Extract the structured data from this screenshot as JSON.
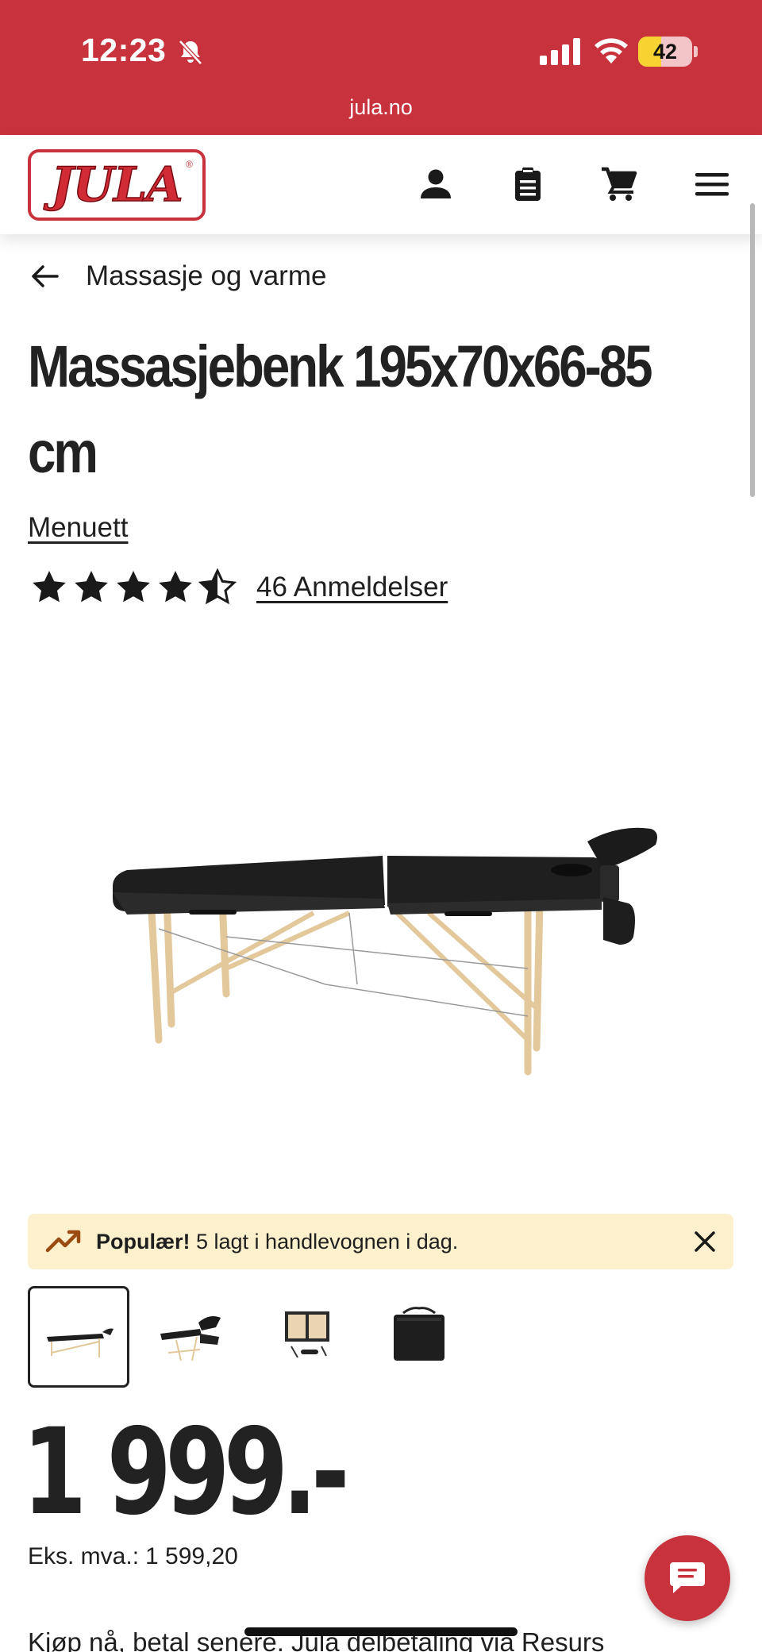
{
  "status_bar": {
    "time": "12:23",
    "battery": "42",
    "battery_level": 0.42
  },
  "browser": {
    "url": "jula.no"
  },
  "header": {
    "logo_text": "JULA",
    "logo_mark": "®"
  },
  "breadcrumb": {
    "label": "Massasje og varme"
  },
  "product": {
    "title_line1": "Massasjebenk 195x70x66-85",
    "title_line2": "cm",
    "brand": "Menuett",
    "rating": 4.5,
    "reviews_label": "46 Anmeldelser",
    "price": "1 999.-",
    "ex_vat_label": "Eks. mva.:",
    "ex_vat_value": "1 599,20",
    "installment_text": "Kjøp nå, betal senere. Jula delbetaling via Resurs"
  },
  "popular_banner": {
    "bold": "Populær!",
    "text": " 5 lagt i handlevognen i dag."
  },
  "thumbnails": [
    "massage-table-side",
    "massage-table-headrest",
    "massage-table-folded-accessories",
    "carry-bag"
  ],
  "colors": {
    "brand_red": "#c8323d",
    "banner_bg": "#fdf0cc",
    "text_dark": "#222222"
  }
}
